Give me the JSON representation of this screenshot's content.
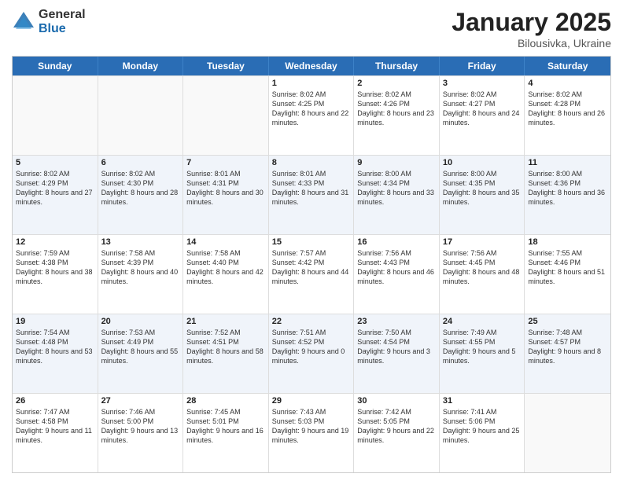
{
  "logo": {
    "general": "General",
    "blue": "Blue"
  },
  "header": {
    "month": "January 2025",
    "location": "Bilousivka, Ukraine"
  },
  "days_of_week": [
    "Sunday",
    "Monday",
    "Tuesday",
    "Wednesday",
    "Thursday",
    "Friday",
    "Saturday"
  ],
  "weeks": [
    [
      {
        "day": "",
        "sunrise": "",
        "sunset": "",
        "daylight": ""
      },
      {
        "day": "",
        "sunrise": "",
        "sunset": "",
        "daylight": ""
      },
      {
        "day": "",
        "sunrise": "",
        "sunset": "",
        "daylight": ""
      },
      {
        "day": "1",
        "sunrise": "8:02 AM",
        "sunset": "4:25 PM",
        "daylight": "8 hours and 22 minutes."
      },
      {
        "day": "2",
        "sunrise": "8:02 AM",
        "sunset": "4:26 PM",
        "daylight": "8 hours and 23 minutes."
      },
      {
        "day": "3",
        "sunrise": "8:02 AM",
        "sunset": "4:27 PM",
        "daylight": "8 hours and 24 minutes."
      },
      {
        "day": "4",
        "sunrise": "8:02 AM",
        "sunset": "4:28 PM",
        "daylight": "8 hours and 26 minutes."
      }
    ],
    [
      {
        "day": "5",
        "sunrise": "8:02 AM",
        "sunset": "4:29 PM",
        "daylight": "8 hours and 27 minutes."
      },
      {
        "day": "6",
        "sunrise": "8:02 AM",
        "sunset": "4:30 PM",
        "daylight": "8 hours and 28 minutes."
      },
      {
        "day": "7",
        "sunrise": "8:01 AM",
        "sunset": "4:31 PM",
        "daylight": "8 hours and 30 minutes."
      },
      {
        "day": "8",
        "sunrise": "8:01 AM",
        "sunset": "4:33 PM",
        "daylight": "8 hours and 31 minutes."
      },
      {
        "day": "9",
        "sunrise": "8:00 AM",
        "sunset": "4:34 PM",
        "daylight": "8 hours and 33 minutes."
      },
      {
        "day": "10",
        "sunrise": "8:00 AM",
        "sunset": "4:35 PM",
        "daylight": "8 hours and 35 minutes."
      },
      {
        "day": "11",
        "sunrise": "8:00 AM",
        "sunset": "4:36 PM",
        "daylight": "8 hours and 36 minutes."
      }
    ],
    [
      {
        "day": "12",
        "sunrise": "7:59 AM",
        "sunset": "4:38 PM",
        "daylight": "8 hours and 38 minutes."
      },
      {
        "day": "13",
        "sunrise": "7:58 AM",
        "sunset": "4:39 PM",
        "daylight": "8 hours and 40 minutes."
      },
      {
        "day": "14",
        "sunrise": "7:58 AM",
        "sunset": "4:40 PM",
        "daylight": "8 hours and 42 minutes."
      },
      {
        "day": "15",
        "sunrise": "7:57 AM",
        "sunset": "4:42 PM",
        "daylight": "8 hours and 44 minutes."
      },
      {
        "day": "16",
        "sunrise": "7:56 AM",
        "sunset": "4:43 PM",
        "daylight": "8 hours and 46 minutes."
      },
      {
        "day": "17",
        "sunrise": "7:56 AM",
        "sunset": "4:45 PM",
        "daylight": "8 hours and 48 minutes."
      },
      {
        "day": "18",
        "sunrise": "7:55 AM",
        "sunset": "4:46 PM",
        "daylight": "8 hours and 51 minutes."
      }
    ],
    [
      {
        "day": "19",
        "sunrise": "7:54 AM",
        "sunset": "4:48 PM",
        "daylight": "8 hours and 53 minutes."
      },
      {
        "day": "20",
        "sunrise": "7:53 AM",
        "sunset": "4:49 PM",
        "daylight": "8 hours and 55 minutes."
      },
      {
        "day": "21",
        "sunrise": "7:52 AM",
        "sunset": "4:51 PM",
        "daylight": "8 hours and 58 minutes."
      },
      {
        "day": "22",
        "sunrise": "7:51 AM",
        "sunset": "4:52 PM",
        "daylight": "9 hours and 0 minutes."
      },
      {
        "day": "23",
        "sunrise": "7:50 AM",
        "sunset": "4:54 PM",
        "daylight": "9 hours and 3 minutes."
      },
      {
        "day": "24",
        "sunrise": "7:49 AM",
        "sunset": "4:55 PM",
        "daylight": "9 hours and 5 minutes."
      },
      {
        "day": "25",
        "sunrise": "7:48 AM",
        "sunset": "4:57 PM",
        "daylight": "9 hours and 8 minutes."
      }
    ],
    [
      {
        "day": "26",
        "sunrise": "7:47 AM",
        "sunset": "4:58 PM",
        "daylight": "9 hours and 11 minutes."
      },
      {
        "day": "27",
        "sunrise": "7:46 AM",
        "sunset": "5:00 PM",
        "daylight": "9 hours and 13 minutes."
      },
      {
        "day": "28",
        "sunrise": "7:45 AM",
        "sunset": "5:01 PM",
        "daylight": "9 hours and 16 minutes."
      },
      {
        "day": "29",
        "sunrise": "7:43 AM",
        "sunset": "5:03 PM",
        "daylight": "9 hours and 19 minutes."
      },
      {
        "day": "30",
        "sunrise": "7:42 AM",
        "sunset": "5:05 PM",
        "daylight": "9 hours and 22 minutes."
      },
      {
        "day": "31",
        "sunrise": "7:41 AM",
        "sunset": "5:06 PM",
        "daylight": "9 hours and 25 minutes."
      },
      {
        "day": "",
        "sunrise": "",
        "sunset": "",
        "daylight": ""
      }
    ]
  ]
}
